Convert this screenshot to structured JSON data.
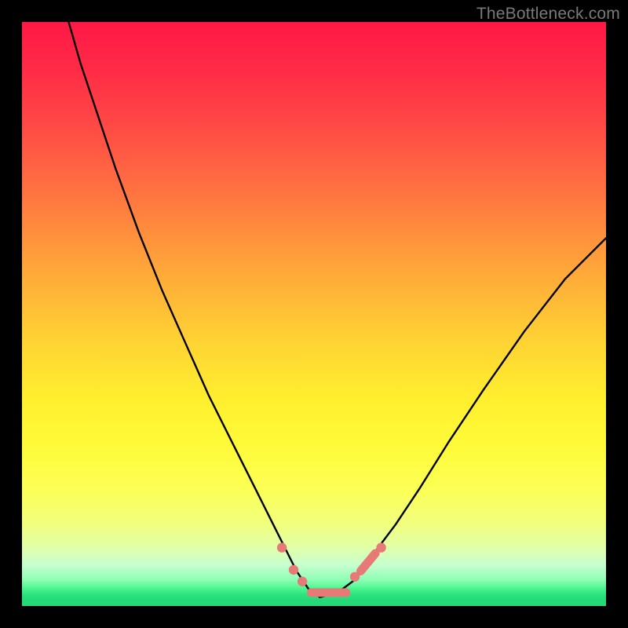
{
  "watermark": {
    "text": "TheBottleneck.com"
  },
  "colors": {
    "curve": "#000000",
    "marker_fill": "#e77a77",
    "marker_stroke": "#d55f5c",
    "background_black": "#000000"
  },
  "chart_data": {
    "type": "line",
    "title": "",
    "xlabel": "",
    "ylabel": "",
    "xlim": [
      0,
      100
    ],
    "ylim": [
      0,
      100
    ],
    "grid": false,
    "note": "Values are read as percentages of the inner plot area. y=0 is the bottom (green), y=100 is the top (red). The curve depicts a bottleneck-style V shape with its minimum near x≈51, touching the bottom green band. Pink markers and segments sit along the curve near the trough.",
    "series": [
      {
        "name": "bottleneck-curve",
        "x": [
          8,
          10,
          13,
          16,
          20,
          24,
          28,
          32,
          36,
          40,
          43,
          45,
          47,
          49,
          51,
          53,
          55,
          57,
          59,
          61,
          64,
          68,
          73,
          79,
          86,
          93,
          100
        ],
        "y": [
          100,
          93,
          84,
          75,
          64,
          54,
          45,
          36,
          28,
          20,
          14,
          10,
          6,
          3,
          1.5,
          2,
          3,
          4.5,
          7,
          10,
          14,
          20,
          28,
          37,
          47,
          56,
          63
        ]
      }
    ],
    "markers": {
      "dots": [
        {
          "x": 44.5,
          "y": 10.0
        },
        {
          "x": 46.5,
          "y": 6.2
        },
        {
          "x": 48.0,
          "y": 4.2
        },
        {
          "x": 57.0,
          "y": 5.0
        },
        {
          "x": 61.5,
          "y": 10.0
        }
      ],
      "segments": [
        {
          "x1": 49.5,
          "y1": 2.3,
          "x2": 55.5,
          "y2": 2.3,
          "thick": true
        },
        {
          "x1": 58.0,
          "y1": 6.0,
          "x2": 60.5,
          "y2": 9.0,
          "thick": true
        }
      ]
    }
  }
}
